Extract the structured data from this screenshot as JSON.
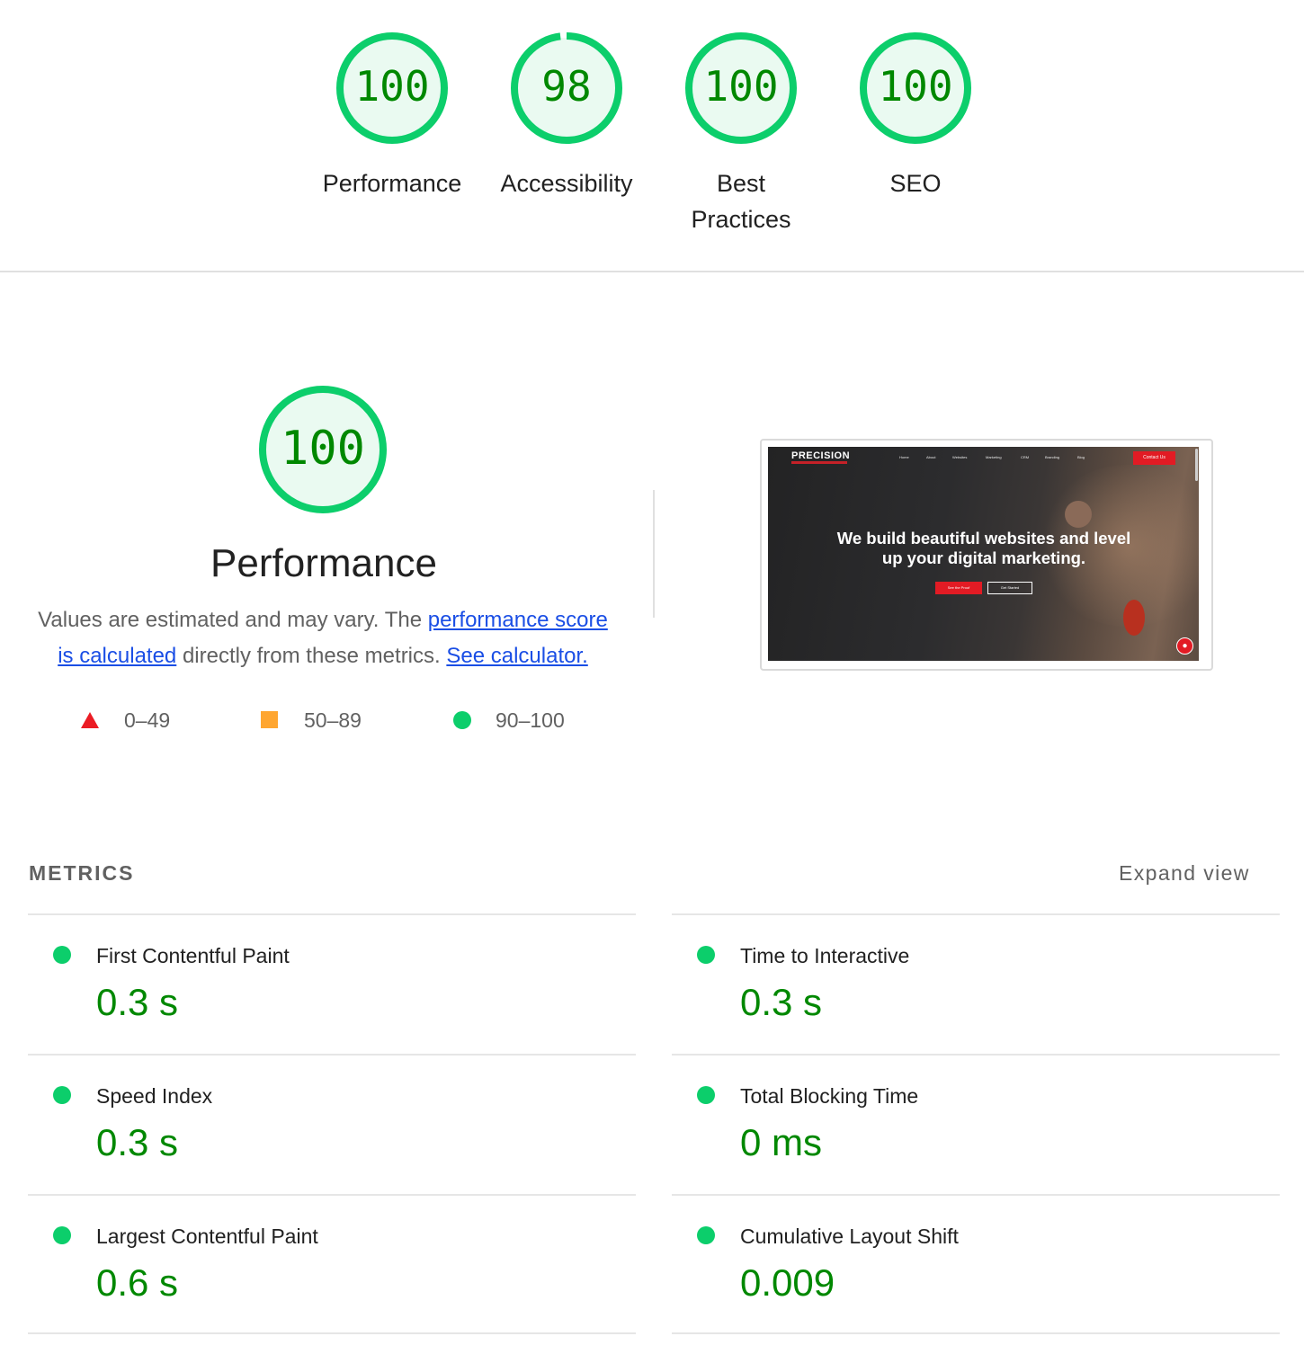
{
  "category_gauges": [
    {
      "score": "100",
      "score_value": 100,
      "label": "Performance"
    },
    {
      "score": "98",
      "score_value": 98,
      "label": "Accessibility"
    },
    {
      "score": "100",
      "score_value": 100,
      "label": "Best Practices"
    },
    {
      "score": "100",
      "score_value": 100,
      "label": "SEO"
    }
  ],
  "performance": {
    "score": "100",
    "score_value": 100,
    "title": "Performance",
    "description_prefix": "Values are estimated and may vary. The ",
    "description_link": "performance score is calculated",
    "description_middle": " directly from these metrics. ",
    "calculator_link": "See calculator."
  },
  "legend": [
    {
      "shape": "triangle",
      "range": "0–49",
      "color": "#eb1c24"
    },
    {
      "shape": "square",
      "range": "50–89",
      "color": "#ffa630"
    },
    {
      "shape": "circle",
      "range": "90–100",
      "color": "#0cce6b"
    }
  ],
  "screenshot": {
    "logo": "PRECISION",
    "nav": [
      "Home",
      "About",
      "Websites",
      "Marketing",
      "CRM",
      "Branding",
      "Blog"
    ],
    "contact_button": "Contact Us",
    "hero_line1": "We build beautiful websites and level",
    "hero_line2": "up your digital marketing.",
    "button_primary": "See the Proof",
    "button_secondary": "Get Started"
  },
  "metrics": {
    "heading": "METRICS",
    "expand_label": "Expand view",
    "items": [
      {
        "title": "First Contentful Paint",
        "value": "0.3 s"
      },
      {
        "title": "Time to Interactive",
        "value": "0.3 s"
      },
      {
        "title": "Speed Index",
        "value": "0.3 s"
      },
      {
        "title": "Total Blocking Time",
        "value": "0 ms"
      },
      {
        "title": "Largest Contentful Paint",
        "value": "0.6 s"
      },
      {
        "title": "Cumulative Layout Shift",
        "value": "0.009"
      }
    ]
  },
  "colors": {
    "pass": "#0cce6b",
    "pass_text": "#008800",
    "pass_bg": "#eafaf1"
  }
}
